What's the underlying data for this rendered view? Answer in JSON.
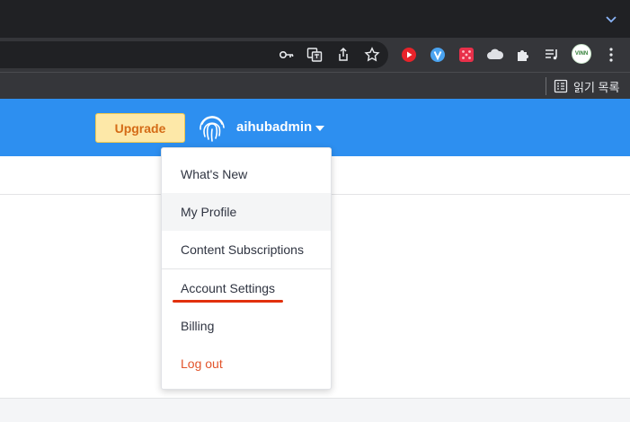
{
  "browser": {
    "toolbar_icons": [
      "key-icon",
      "translate-icon",
      "share-icon",
      "star-icon",
      "youtube-extension-icon",
      "extension-v-icon",
      "extension-dots-icon",
      "cloud-extension-icon",
      "puzzle-icon",
      "media-queue-icon",
      "profile-avatar-icon",
      "kebab-menu-icon"
    ],
    "profile_badge": "VINN",
    "reading_list_label": "읽기 목록"
  },
  "header": {
    "upgrade_label": "Upgrade",
    "username": "aihubadmin",
    "brand_color": "#2d8ff0",
    "upgrade_bg": "#fde8a8",
    "upgrade_text_color": "#d46b16"
  },
  "user_menu": {
    "items": [
      {
        "label": "What's New"
      },
      {
        "label": "My Profile"
      },
      {
        "label": "Content Subscriptions"
      },
      {
        "label": "Account Settings"
      },
      {
        "label": "Billing"
      },
      {
        "label": "Log out"
      }
    ],
    "hovered_item": "My Profile",
    "annotated_item": "Account Settings",
    "logout_color": "#e2542b",
    "annotation_color": "#e2300c"
  }
}
